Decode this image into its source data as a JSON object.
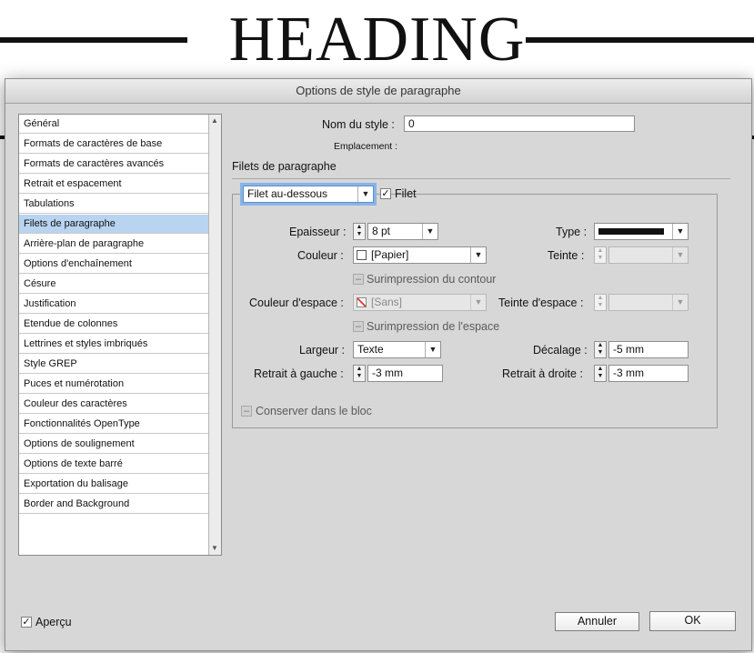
{
  "heading": "HEADING",
  "dialog": {
    "title": "Options de style de paragraphe",
    "style_name_label": "Nom du style :",
    "style_name_value": "0",
    "location_label": "Emplacement :",
    "section_title": "Filets de paragraphe",
    "sidebar": {
      "items": [
        {
          "label": "Général"
        },
        {
          "label": "Formats de caractères de base"
        },
        {
          "label": "Formats de caractères avancés"
        },
        {
          "label": "Retrait et espacement"
        },
        {
          "label": "Tabulations"
        },
        {
          "label": "Filets de paragraphe"
        },
        {
          "label": "Arrière-plan de paragraphe"
        },
        {
          "label": "Options d'enchaînement"
        },
        {
          "label": "Césure"
        },
        {
          "label": "Justification"
        },
        {
          "label": "Etendue de colonnes"
        },
        {
          "label": "Lettrines et styles imbriqués"
        },
        {
          "label": "Style GREP"
        },
        {
          "label": "Puces et numérotation"
        },
        {
          "label": "Couleur des caractères"
        },
        {
          "label": "Fonctionnalités OpenType"
        },
        {
          "label": "Options de soulignement"
        },
        {
          "label": "Options de texte barré"
        },
        {
          "label": "Exportation du balisage"
        },
        {
          "label": "Border and Background"
        }
      ],
      "selected": "Filets de paragraphe"
    },
    "rule": {
      "position_select": "Filet au-dessous",
      "enable_label": "Filet",
      "thickness_label": "Epaisseur :",
      "thickness_value": "8 pt",
      "type_label": "Type :",
      "color_label": "Couleur :",
      "color_value": "[Papier]",
      "tint_label": "Teinte :",
      "overprint_stroke_label": "Surimpression du contour",
      "gap_color_label": "Couleur d'espace :",
      "gap_color_value": "[Sans]",
      "gap_tint_label": "Teinte d'espace :",
      "overprint_gap_label": "Surimpression de l'espace",
      "width_label": "Largeur :",
      "width_value": "Texte",
      "offset_label": "Décalage :",
      "offset_value": "-5 mm",
      "left_indent_label": "Retrait à gauche :",
      "left_indent_value": "-3 mm",
      "right_indent_label": "Retrait à droite :",
      "right_indent_value": "-3 mm",
      "keep_in_frame_label": "Conserver dans le bloc"
    },
    "preview_label": "Aperçu",
    "cancel_label": "Annuler",
    "ok_label": "OK",
    "check_mark": "✓",
    "minus_mark": "–"
  }
}
